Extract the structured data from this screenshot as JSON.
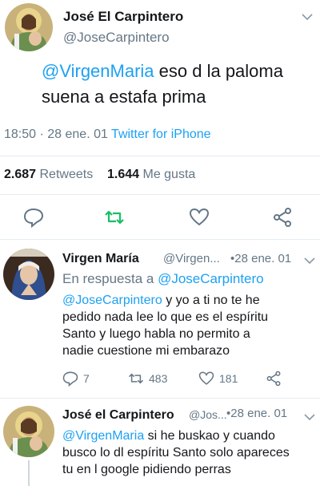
{
  "main_tweet": {
    "author_name": "José El Carpintero",
    "author_handle": "@JoseCarpintero",
    "mention": "@VirgenMaria",
    "text_line1_rest": " eso d la paloma",
    "text_line2": "suena a estafa prima",
    "time": "18:50 · 28 ene. 01",
    "source": "Twitter for iPhone",
    "retweets_count": "2.687",
    "retweets_label": "Retweets",
    "likes_count": "1.644",
    "likes_label": "Me gusta"
  },
  "reply_1": {
    "author_name": "Virgen María",
    "author_handle": "@Virgen...",
    "date": "•28 ene. 01",
    "in_reply_prefix": "En respuesta a ",
    "in_reply_handle": "@JoseCarpintero",
    "mention": "@JoseCarpintero",
    "text_line1_rest": " y yo a ti no te he",
    "text_line2": "pedido nada lee lo que es el espíritu",
    "text_line3": "Santo y luego habla no permito a",
    "text_line4": "nadie cuestione mi embarazo",
    "reply_count": "7",
    "retweet_count": "483",
    "like_count": "181"
  },
  "reply_2": {
    "author_name": "José el Carpintero",
    "author_handle": "@Jos...",
    "date": "•28 ene. 01",
    "mention": "@VirgenMaria",
    "text_line1_rest": " si he buskao y cuando",
    "text_line2": "busco lo dl espíritu Santo solo apareces",
    "text_line3": "tu en l google pidiendo perras"
  },
  "colors": {
    "link": "#1da1f2",
    "muted": "#657786",
    "retweet_green": "#17bf63",
    "divider": "#e6ecf0"
  },
  "icons": [
    "chevron-down-icon",
    "reply-icon",
    "retweet-icon",
    "like-icon",
    "share-icon"
  ]
}
